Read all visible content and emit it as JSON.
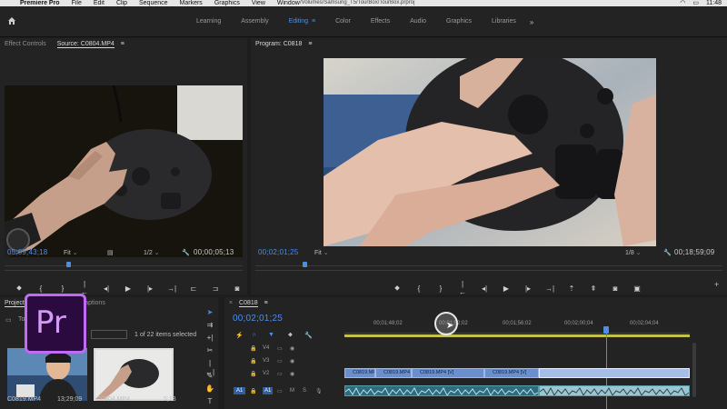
{
  "menubar": {
    "app_name": "Premiere Pro",
    "items": [
      "File",
      "Edit",
      "Clip",
      "Sequence",
      "Markers",
      "Graphics",
      "View",
      "Window"
    ],
    "project_path": "/Volumes/Samsung_T5/TourBox/TourBox.prproj",
    "time": "11:48"
  },
  "workspace": {
    "tabs": [
      "Learning",
      "Assembly",
      "Editing",
      "Color",
      "Effects",
      "Audio",
      "Graphics",
      "Libraries"
    ],
    "active_tab": "Editing"
  },
  "source_monitor": {
    "tab_effect_controls": "Effect Controls",
    "tab_source": "Source: C0804.MP4",
    "timecode_current": "05;09;43;18",
    "zoom": "Fit",
    "resolution": "1/2",
    "duration": "00;00;05;13"
  },
  "program_monitor": {
    "title": "Program: C0818",
    "timecode_current": "00;02;01;25",
    "zoom": "Fit",
    "resolution": "1/8",
    "duration": "00;18;59;09"
  },
  "project_panel": {
    "tab_project": "Project: TourBox",
    "tab_captions": "Captions",
    "bin_name": "TourBox",
    "items_selected": "1 of 22 items selected",
    "items": [
      {
        "name": "C0819.MP4",
        "duration": "13;29;09"
      },
      {
        "name": "C0804.MP4",
        "duration": "5;13"
      }
    ]
  },
  "timeline": {
    "sequence_name": "C0818",
    "timecode": "00;02;01;25",
    "ruler_labels": [
      "00;01;48;02",
      "00;01;52;02",
      "00;01;56;02",
      "00;02;00;04",
      "00;02;04;04"
    ],
    "tracks": {
      "video": [
        "V4",
        "V3",
        "V2"
      ],
      "audio": [
        "A1"
      ]
    },
    "audio_source": "A1",
    "audio_track_buttons": [
      "M",
      "S"
    ],
    "v2_clips": [
      "C0819.MP4",
      "C0819.MP4 [V]",
      "C0819.MP4 [V]",
      "C0819.MP4 [V]"
    ],
    "colors": {
      "accent_blue": "#4b8ee8",
      "video_clip": "#6b8fcd",
      "audio_clip": "#2e6d7d",
      "work_area": "#c4c24a"
    }
  },
  "icons": {
    "premiere_logo_text": "Pr"
  }
}
